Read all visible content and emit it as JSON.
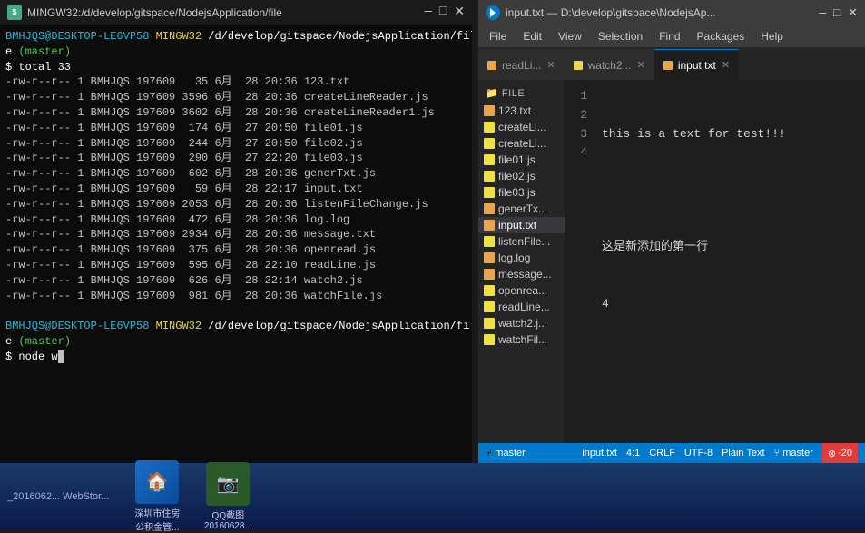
{
  "terminal": {
    "title": "MINGW32:/d/develop/gitspace/NodejsApplication/file",
    "icon": "terminal",
    "lines": [
      "BMHJQS@DESKTOP-LE6VP58 MINGW32 /d/develop/gitspace/NodejsApplication/fil",
      "e (master)",
      "$ total 33",
      "-rw-r--r-- 1 BMHJQS 197609   35 6月  28 20:36 123.txt",
      "-rw-r--r-- 1 BMHJQS 197609 3596 6月  28 20:36 createLineReader.js",
      "-rw-r--r-- 1 BMHJQS 197609 3602 6月  28 20:36 createLineReader1.js",
      "-rw-r--r-- 1 BMHJQS 197609  174 6月  27 20:50 file01.js",
      "-rw-r--r-- 1 BMHJQS 197609  244 6月  27 20:50 file02.js",
      "-rw-r--r-- 1 BMHJQS 197609  290 6月  27 22:20 file03.js",
      "-rw-r--r-- 1 BMHJQS 197609  602 6月  28 20:36 generTxt.js",
      "-rw-r--r-- 1 BMHJQS 197609   59 6月  28 22:17 input.txt",
      "-rw-r--r-- 1 BMHJQS 197609 2053 6月  28 20:36 listenFileChange.js",
      "-rw-r--r-- 1 BMHJQS 197609  472 6月  28 20:36 log.log",
      "-rw-r--r-- 1 BMHJQS 197609 2934 6月  28 20:36 message.txt",
      "-rw-r--r-- 1 BMHJQS 197609  375 6月  28 20:36 openread.js",
      "-rw-r--r-- 1 BMHJQS 197609  595 6月  28 22:10 readLine.js",
      "-rw-r--r-- 1 BMHJQS 197609  626 6月  28 22:14 watch2.js",
      "-rw-r--r-- 1 BMHJQS 197609  981 6月  28 20:36 watchFile.js",
      "",
      "BMHJQS@DESKTOP-LE6VP58 MINGW32 /d/develop/gitspace/NodejsApplication/fil",
      "e (master)",
      "$ node w"
    ],
    "cursor": "▌"
  },
  "vscode": {
    "title": "input.txt — D:\\develop\\gitspace\\NodejsAp...",
    "menu": [
      "File",
      "Edit",
      "View",
      "Selection",
      "Find",
      "Packages",
      "Help"
    ],
    "tabs": [
      {
        "label": "readLi...",
        "dot": false,
        "active": false
      },
      {
        "label": "watch2...",
        "dot": false,
        "active": false
      },
      {
        "label": "input.txt",
        "dot": false,
        "active": true
      }
    ],
    "explorer": {
      "title": "file",
      "files": [
        {
          "name": "123.txt",
          "icon": "orange",
          "active": false
        },
        {
          "name": "createLi...",
          "icon": "yellow",
          "active": false
        },
        {
          "name": "createLi...",
          "icon": "yellow",
          "active": false
        },
        {
          "name": "file01.js",
          "icon": "yellow",
          "active": false
        },
        {
          "name": "file02.js",
          "icon": "yellow",
          "active": false
        },
        {
          "name": "file03.js",
          "icon": "yellow",
          "active": false
        },
        {
          "name": "generTx...",
          "icon": "orange",
          "active": false
        },
        {
          "name": "input.txt",
          "icon": "orange",
          "active": true
        },
        {
          "name": "listenFile...",
          "icon": "yellow",
          "active": false
        },
        {
          "name": "log.log",
          "icon": "orange",
          "active": false
        },
        {
          "name": "message...",
          "icon": "orange",
          "active": false
        },
        {
          "name": "openrea...",
          "icon": "yellow",
          "active": false
        },
        {
          "name": "readLine...",
          "icon": "yellow",
          "active": false
        },
        {
          "name": "watch2.j...",
          "icon": "yellow",
          "active": false
        },
        {
          "name": "watchFil...",
          "icon": "yellow",
          "active": false
        }
      ]
    },
    "editor": {
      "line_numbers": [
        "1",
        "2",
        "3",
        "4"
      ],
      "lines": [
        "this is a text for test!!!",
        "",
        "这是新添加的第一行",
        "4"
      ]
    },
    "statusbar": {
      "git_branch": "master",
      "position": "4:1",
      "file": "input.txt",
      "encoding": "UTF-8",
      "line_ending": "CRLF",
      "language": "Plain Text",
      "error_code": "-20"
    }
  },
  "taskbar": {
    "apps": [
      {
        "label": "深圳市住房\n公积金管...",
        "color": "#1a6ec9"
      },
      {
        "label": "QQ截图\n20160628...",
        "color": "#2a8a2a"
      }
    ],
    "bottom_text": "_2016062...   WebStor..."
  }
}
